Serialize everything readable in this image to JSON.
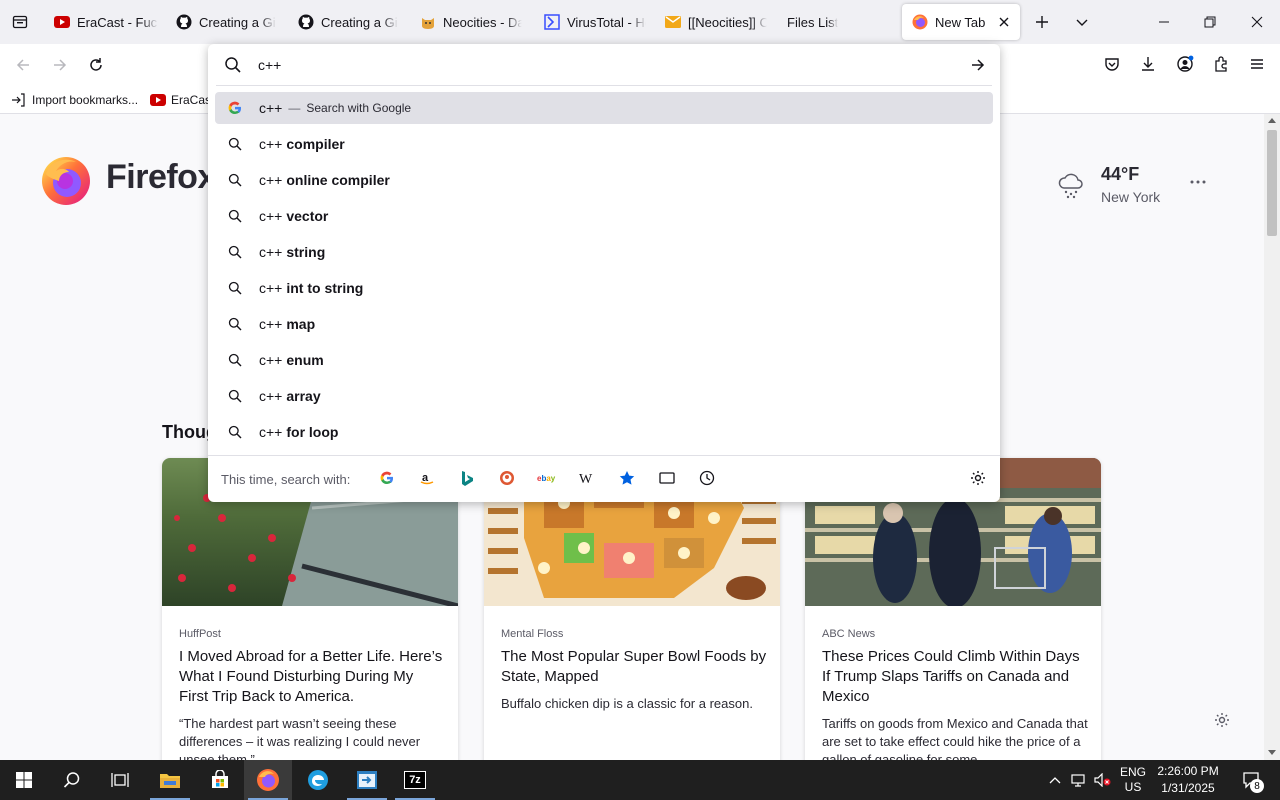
{
  "browser": {
    "tabs": [
      {
        "label": "EraCast - Fucky",
        "favicon": "youtube-icon",
        "color": "#cc0000"
      },
      {
        "label": "Creating a GitH",
        "favicon": "github-icon",
        "color": "#15141a"
      },
      {
        "label": "Creating a GitH",
        "favicon": "github-icon",
        "color": "#15141a"
      },
      {
        "label": "Neocities - Das",
        "favicon": "neocities-cat-icon",
        "color": "#e4a23a"
      },
      {
        "label": "VirusTotal - Ho",
        "favicon": "virustotal-icon",
        "color": "#394eff"
      },
      {
        "label": "[[Neocities]] Co",
        "favicon": "mail-icon",
        "color": "#f2a818"
      },
      {
        "label": "Files List",
        "favicon": "",
        "color": ""
      },
      {
        "label": "New Tab",
        "favicon": "firefox-icon",
        "color": "#ff7139",
        "active": true
      }
    ],
    "url_input_value": "c++",
    "bookmarks": [
      {
        "label": "Import bookmarks...",
        "icon": "import-icon"
      },
      {
        "label": "EraCast",
        "icon": "youtube-icon"
      }
    ]
  },
  "urlbar_dropdown": {
    "heuristic": {
      "query": "c++",
      "separator": "—",
      "action": "Search with Google"
    },
    "suggestions": [
      {
        "query": "c++",
        "completion": "compiler"
      },
      {
        "query": "c++",
        "completion": "online compiler"
      },
      {
        "query": "c++",
        "completion": "vector"
      },
      {
        "query": "c++",
        "completion": "string"
      },
      {
        "query": "c++",
        "completion": "int to string"
      },
      {
        "query": "c++",
        "completion": "map"
      },
      {
        "query": "c++",
        "completion": "enum"
      },
      {
        "query": "c++",
        "completion": "array"
      },
      {
        "query": "c++",
        "completion": "for loop"
      }
    ],
    "one_off_label": "This time, search with:",
    "engines": [
      "google-icon",
      "amazon-icon",
      "bing-icon",
      "duckduckgo-icon",
      "ebay-icon",
      "wikipedia-icon",
      "bookmarks-star-icon",
      "tabs-icon",
      "history-icon"
    ]
  },
  "newtab": {
    "brand": "Firefox",
    "weather": {
      "temp": "44°F",
      "city": "New York",
      "icon": "snow-cloud-icon"
    },
    "section_heading": "Thoug",
    "stories": [
      {
        "source": "HuffPost",
        "title": "I Moved Abroad for a Better Life. Here’s What I Found Disturbing During My First Trip Back to America.",
        "excerpt": "“The hardest part wasn’t seeing these differences – it was realizing I could never unsee them.”"
      },
      {
        "source": "Mental Floss",
        "title": "The Most Popular Super Bowl Foods by State, Mapped",
        "excerpt": "Buffalo chicken dip is a classic for a reason."
      },
      {
        "source": "ABC News",
        "title": "These Prices Could Climb Within Days If Trump Slaps Tariffs on Canada and Mexico",
        "excerpt": "Tariffs on goods from Mexico and Canada that are set to take effect could hike the price of a gallon of gasoline for some"
      }
    ]
  },
  "taskbar": {
    "apps": [
      "windows-start-icon",
      "search-icon",
      "task-view-icon",
      "file-explorer-icon",
      "store-icon",
      "firefox-icon",
      "edge-icon",
      "app-icon",
      "7zip-icon"
    ],
    "app_7zip_label": "7z",
    "lang": "ENG",
    "region": "US",
    "time": "2:26:00 PM",
    "date": "1/31/2025",
    "notifications": "8"
  },
  "colors": {
    "accent": "#0061e0",
    "tab_strip": "#f0f0f4",
    "taskbar": "#1f1f1f"
  }
}
